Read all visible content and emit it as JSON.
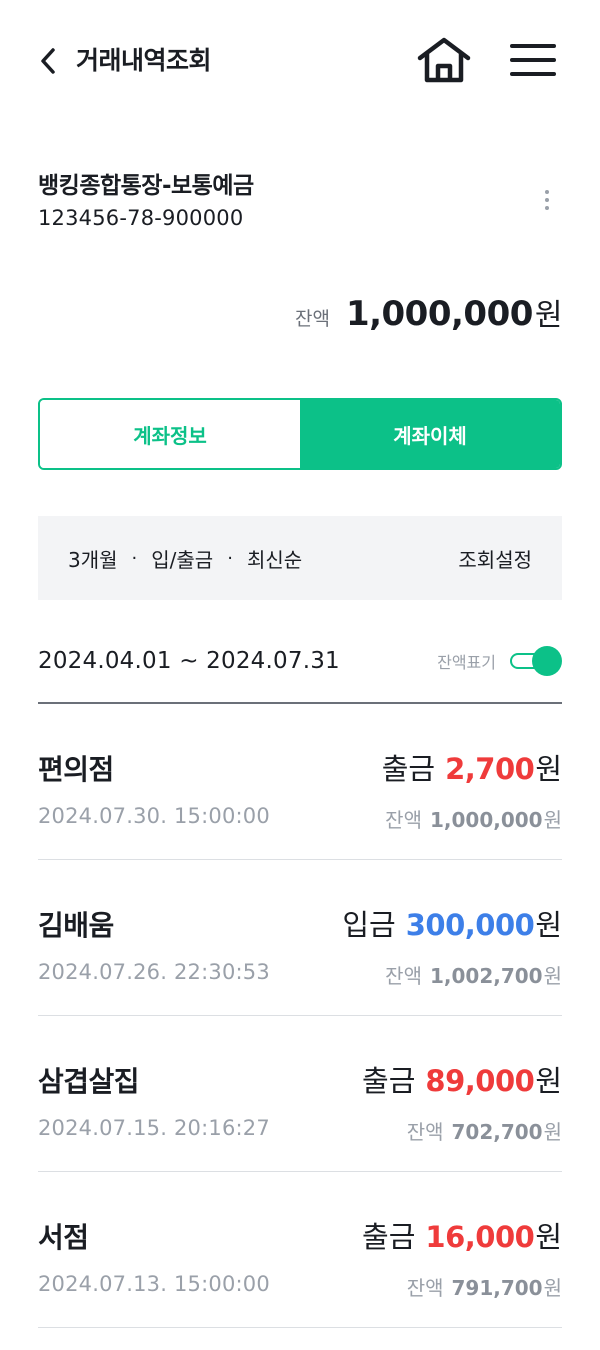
{
  "header": {
    "title": "거래내역조회",
    "back_icon": "chevron-left-icon",
    "home_icon": "home-icon",
    "menu_icon": "hamburger-menu-icon"
  },
  "account": {
    "name": "뱅킹종합통장-보통예금",
    "number": "123456-78-900000",
    "balance_label": "잔액",
    "balance_amount": "1,000,000",
    "balance_unit": "원"
  },
  "actions": {
    "info_label": "계좌정보",
    "transfer_label": "계좌이체"
  },
  "filter": {
    "period": "3개월",
    "type": "입/출금",
    "order": "최신순",
    "separator": "·",
    "setting_label": "조회설정"
  },
  "range": {
    "text": "2024.04.01 ~ 2024.07.31",
    "toggle_label": "잔액표기",
    "toggle_on": true
  },
  "colors": {
    "accent": "#0cc188",
    "withdrawal": "#ef3b3b",
    "deposit": "#3d7fe8"
  },
  "transactions": [
    {
      "name": "편의점",
      "type": "출금",
      "direction": "out",
      "amount": "2,700",
      "unit": "원",
      "datetime": "2024.07.30. 15:00:00",
      "balance_label": "잔액",
      "balance": "1,000,000",
      "balance_unit": "원"
    },
    {
      "name": "김배움",
      "type": "입금",
      "direction": "in",
      "amount": "300,000",
      "unit": "원",
      "datetime": "2024.07.26. 22:30:53",
      "balance_label": "잔액",
      "balance": "1,002,700",
      "balance_unit": "원"
    },
    {
      "name": "삼겹살집",
      "type": "출금",
      "direction": "out",
      "amount": "89,000",
      "unit": "원",
      "datetime": "2024.07.15. 20:16:27",
      "balance_label": "잔액",
      "balance": "702,700",
      "balance_unit": "원"
    },
    {
      "name": "서점",
      "type": "출금",
      "direction": "out",
      "amount": "16,000",
      "unit": "원",
      "datetime": "2024.07.13. 15:00:00",
      "balance_label": "잔액",
      "balance": "791,700",
      "balance_unit": "원"
    }
  ]
}
